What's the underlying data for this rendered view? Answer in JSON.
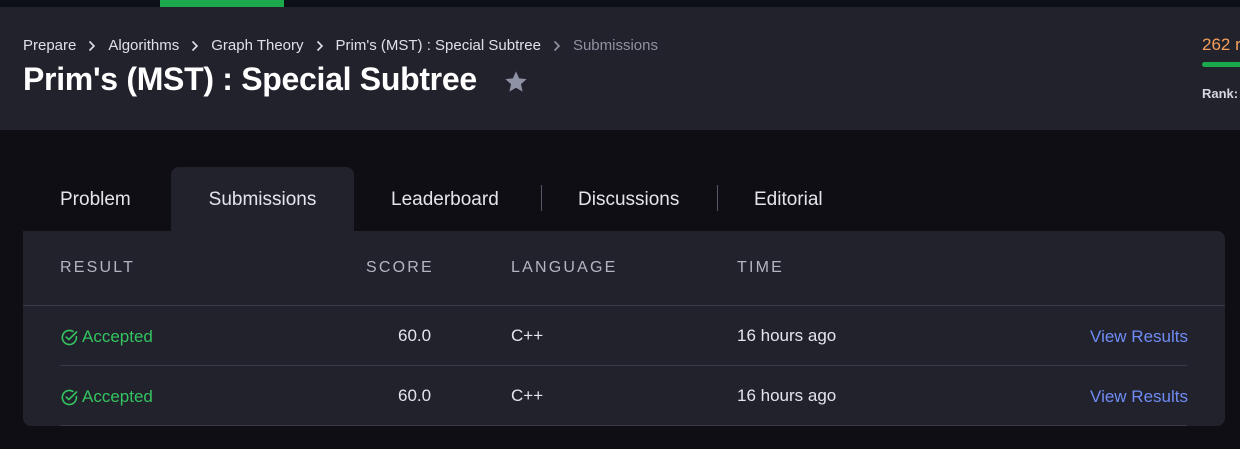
{
  "breadcrumb": {
    "items": [
      "Prepare",
      "Algorithms",
      "Graph Theory",
      "Prim's (MST) : Special Subtree",
      "Submissions"
    ]
  },
  "page_title": "Prim's (MST) : Special Subtree",
  "score_widget": {
    "score_text": "262 r",
    "rank_label": "Rank:"
  },
  "tabs": [
    "Problem",
    "Submissions",
    "Leaderboard",
    "Discussions",
    "Editorial"
  ],
  "active_tab": "Submissions",
  "table": {
    "headers": [
      "RESULT",
      "SCORE",
      "LANGUAGE",
      "TIME"
    ],
    "rows": [
      {
        "result": "Accepted",
        "score": "60.0",
        "language": "C++",
        "time": "16 hours ago",
        "action": "View Results"
      },
      {
        "result": "Accepted",
        "score": "60.0",
        "language": "C++",
        "time": "16 hours ago",
        "action": "View Results"
      }
    ]
  },
  "colors": {
    "accent_green": "#1ba94c",
    "accepted": "#33c45f",
    "link": "#6f8cf5",
    "score_orange": "#f5a05a"
  },
  "icons": [
    "chevron-right-icon",
    "star-icon",
    "check-circle-icon"
  ]
}
